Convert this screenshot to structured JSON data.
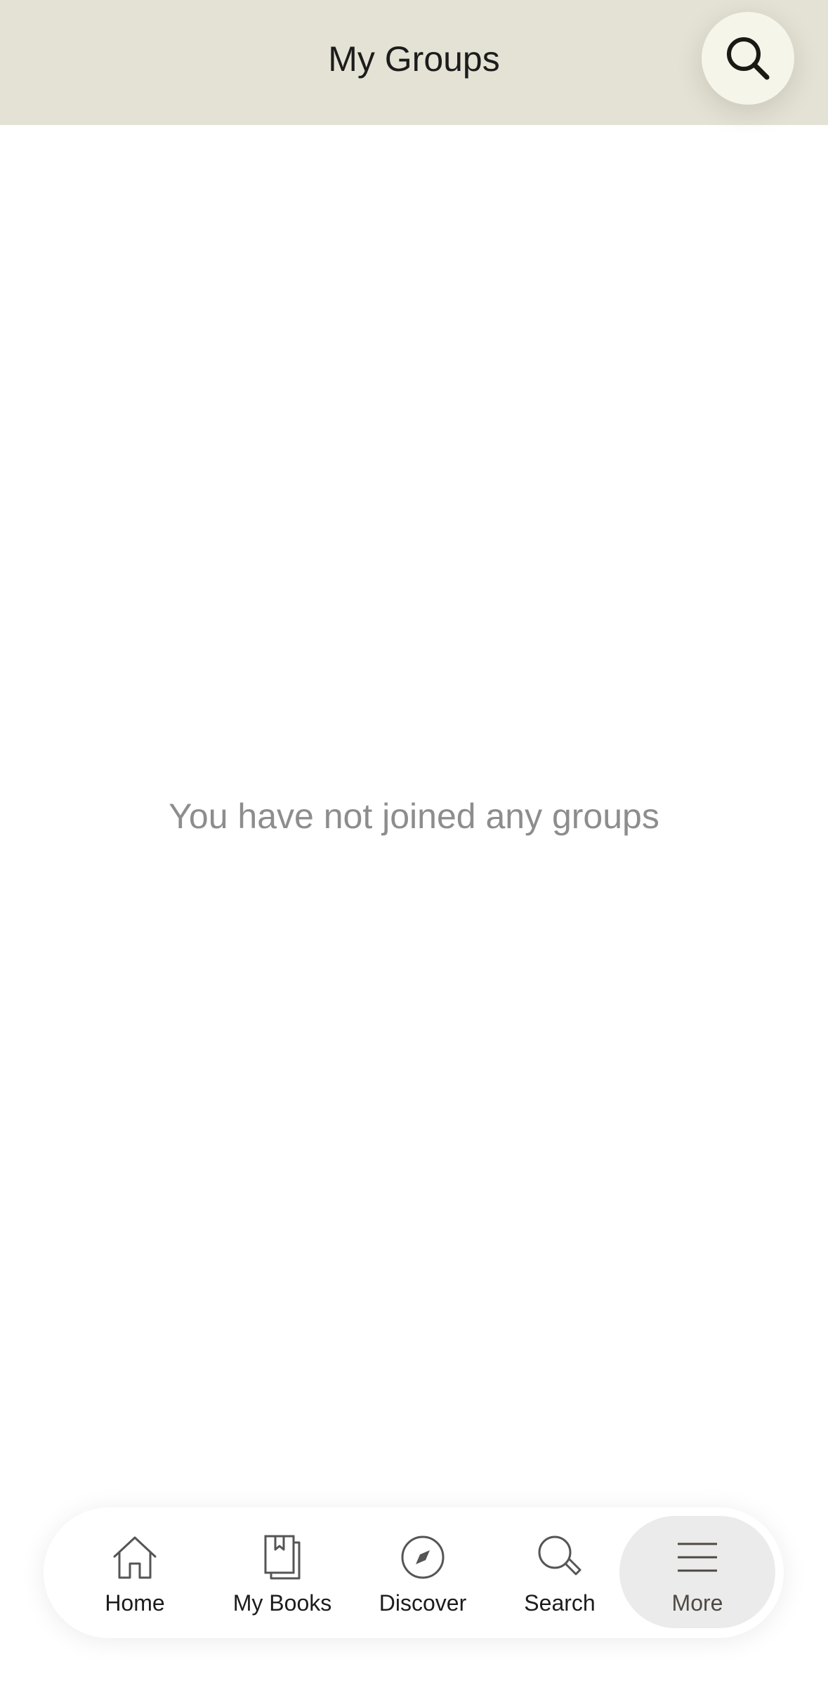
{
  "header": {
    "title": "My Groups"
  },
  "search_button": {
    "icon": "search-icon"
  },
  "main": {
    "empty_message": "You have not joined any groups"
  },
  "tabbar": {
    "items": [
      {
        "label": "Home",
        "icon": "home-icon"
      },
      {
        "label": "My Books",
        "icon": "books-icon"
      },
      {
        "label": "Discover",
        "icon": "compass-icon"
      },
      {
        "label": "Search",
        "icon": "search-icon"
      },
      {
        "label": "More",
        "icon": "menu-icon",
        "active": true
      }
    ]
  },
  "colors": {
    "header_bg": "#e4e2d4",
    "fab_bg": "#f6f5e9",
    "active_tab_bg": "#ebebeb",
    "empty_text": "#8d8d8d"
  }
}
